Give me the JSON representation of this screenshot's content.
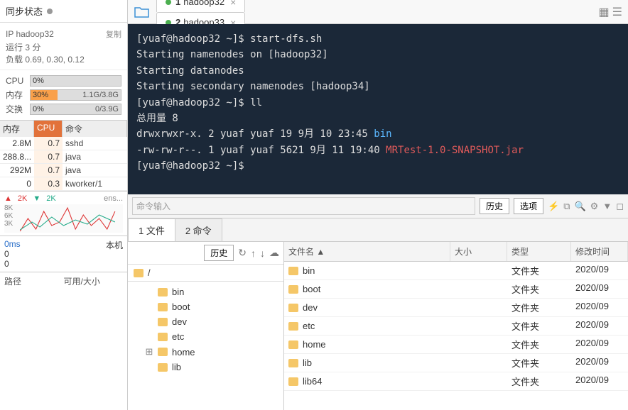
{
  "sidebar": {
    "sync_label": "同步状态",
    "host_label": "IP hadoop32",
    "copy_label": "复制",
    "uptime": "运行 3 分",
    "load": "负载 0.69, 0.30, 0.12",
    "metrics": {
      "cpu": {
        "label": "CPU",
        "value": "0%",
        "right": ""
      },
      "mem": {
        "label": "内存",
        "value": "30%",
        "right": "1.1G/3.8G",
        "fill": 30
      },
      "swap": {
        "label": "交换",
        "value": "0%",
        "right": "0/3.9G"
      }
    },
    "proc_headers": {
      "mem": "内存",
      "cpu": "CPU",
      "cmd": "命令"
    },
    "processes": [
      {
        "mem": "2.8M",
        "cpu": "0.7",
        "cmd": "sshd"
      },
      {
        "mem": "288.8...",
        "cpu": "0.7",
        "cmd": "java"
      },
      {
        "mem": "292M",
        "cpu": "0.7",
        "cmd": "java"
      },
      {
        "mem": "0",
        "cpu": "0.3",
        "cmd": "kworker/1"
      }
    ],
    "net": {
      "up": "2K",
      "down": "2K",
      "iface": "ens...",
      "axis": [
        "8K",
        "6K",
        "3K"
      ]
    },
    "latency": {
      "left_label": "0ms",
      "right_label": "本机",
      "vals": [
        "0",
        "0"
      ]
    },
    "path_hdr": {
      "path": "路径",
      "avail": "可用/大小"
    }
  },
  "tabs": [
    {
      "index": "1",
      "name": "hadoop32",
      "active": true
    },
    {
      "index": "2",
      "name": "hadoop33",
      "active": false
    }
  ],
  "terminal": {
    "lines": [
      {
        "t": "[yuaf@hadoop32 ~]$ start-dfs.sh"
      },
      {
        "t": "Starting namenodes on [hadoop32]"
      },
      {
        "t": "Starting datanodes"
      },
      {
        "t": "Starting secondary namenodes [hadoop34]"
      },
      {
        "t": "[yuaf@hadoop32 ~]$ ll"
      },
      {
        "t": "总用量 8"
      },
      {
        "perm": "drwxrwxr-x. 2 yuaf yuaf   19 9月   10 23:45 ",
        "name": "bin",
        "cls": "term-blue"
      },
      {
        "perm": "-rw-rw-r--. 1 yuaf yuaf 5621 9月   11 19:40 ",
        "name": "MRTest-1.0-SNAPSHOT.jar",
        "cls": "term-red"
      },
      {
        "t": "[yuaf@hadoop32 ~]$ "
      }
    ]
  },
  "cmd_input": {
    "placeholder": "命令输入",
    "history": "历史",
    "options": "选项"
  },
  "sub_tabs": [
    {
      "label": "1 文件",
      "active": true
    },
    {
      "label": "2 命令",
      "active": false
    }
  ],
  "file_left": {
    "history": "历史",
    "root": "/",
    "items": [
      "bin",
      "boot",
      "dev",
      "etc",
      "home",
      "lib"
    ]
  },
  "file_right": {
    "headers": {
      "name": "文件名 ▲",
      "size": "大小",
      "type": "类型",
      "date": "修改时间"
    },
    "rows": [
      {
        "name": "bin",
        "type": "文件夹",
        "date": "2020/09"
      },
      {
        "name": "boot",
        "type": "文件夹",
        "date": "2020/09"
      },
      {
        "name": "dev",
        "type": "文件夹",
        "date": "2020/09"
      },
      {
        "name": "etc",
        "type": "文件夹",
        "date": "2020/09"
      },
      {
        "name": "home",
        "type": "文件夹",
        "date": "2020/09"
      },
      {
        "name": "lib",
        "type": "文件夹",
        "date": "2020/09"
      },
      {
        "name": "lib64",
        "type": "文件夹",
        "date": "2020/09"
      }
    ]
  }
}
